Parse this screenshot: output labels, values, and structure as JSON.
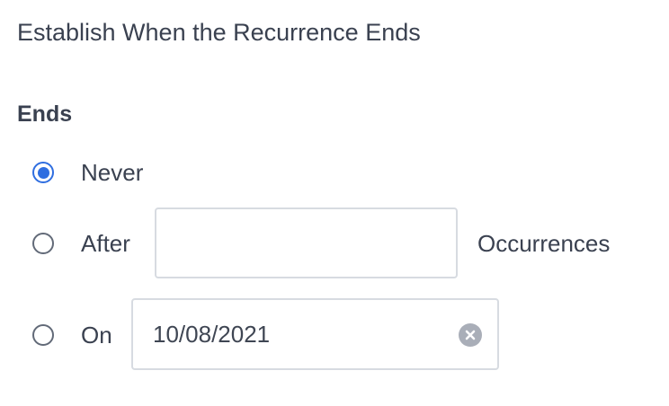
{
  "section": {
    "title": "Establish When the Recurrence Ends"
  },
  "ends": {
    "label": "Ends",
    "options": [
      {
        "label": "Never",
        "selected": true
      },
      {
        "label": "After",
        "selected": false
      },
      {
        "label": "On",
        "selected": false
      }
    ],
    "after": {
      "value": "",
      "placeholder": "",
      "suffix": "Occurrences"
    },
    "on": {
      "date": "10/08/2021",
      "clear_icon": "clear-x-icon"
    }
  },
  "colors": {
    "accent": "#2f6ee0",
    "text": "#3a4150",
    "border": "#d7dbe1",
    "clear_icon_bg": "#a9aeb8"
  }
}
